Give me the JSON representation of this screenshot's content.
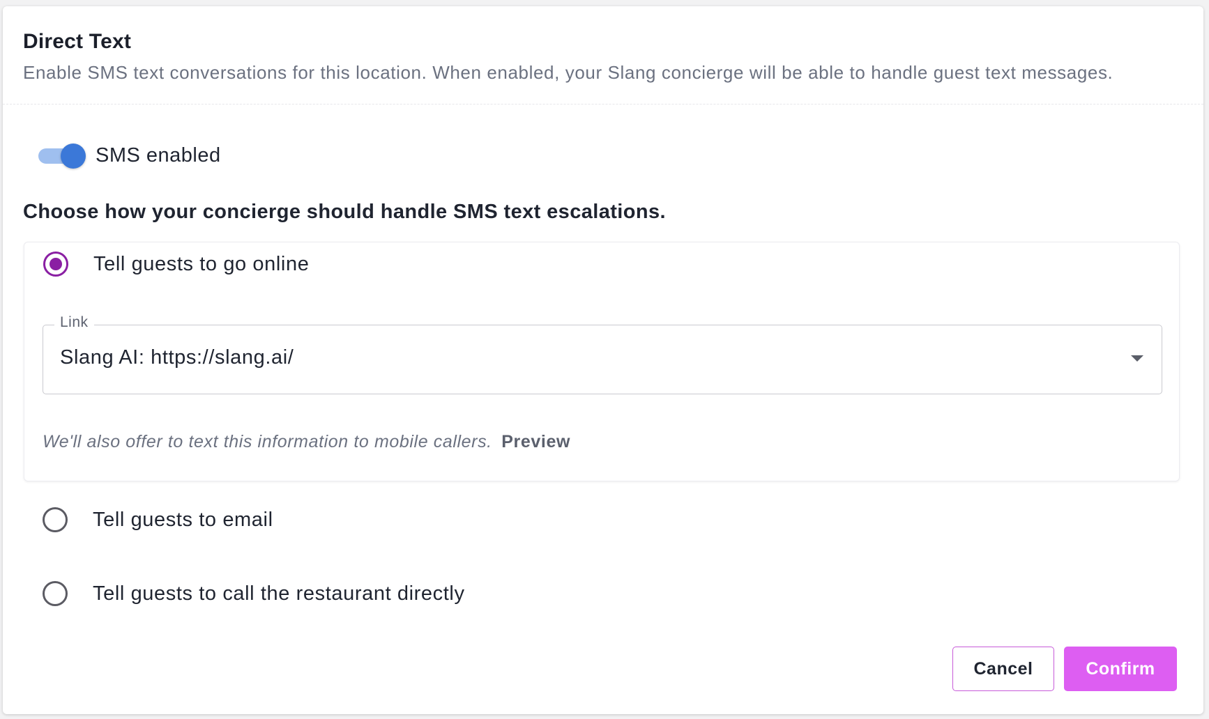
{
  "dialog": {
    "title": "Direct Text",
    "subtitle": "Enable SMS text conversations for this location. When enabled, your Slang concierge will be able to handle guest text messages."
  },
  "sms_toggle": {
    "label": "SMS enabled",
    "enabled": true
  },
  "escalation": {
    "question": "Choose how your concierge should handle SMS text escalations.",
    "options": [
      {
        "label": "Tell guests to go online",
        "selected": true,
        "link_field": {
          "legend": "Link",
          "value": "Slang AI: https://slang.ai/"
        },
        "helper_text": "We'll also offer to text this information to mobile callers.",
        "preview_label": "Preview"
      },
      {
        "label": "Tell guests to email",
        "selected": false
      },
      {
        "label": "Tell guests to call the restaurant directly",
        "selected": false
      }
    ]
  },
  "actions": {
    "cancel_label": "Cancel",
    "confirm_label": "Confirm"
  },
  "colors": {
    "accent": "#dd5ef2",
    "radio_selected": "#8a1fa3",
    "toggle_knob": "#3b78d8",
    "toggle_track": "#9fbfef"
  }
}
